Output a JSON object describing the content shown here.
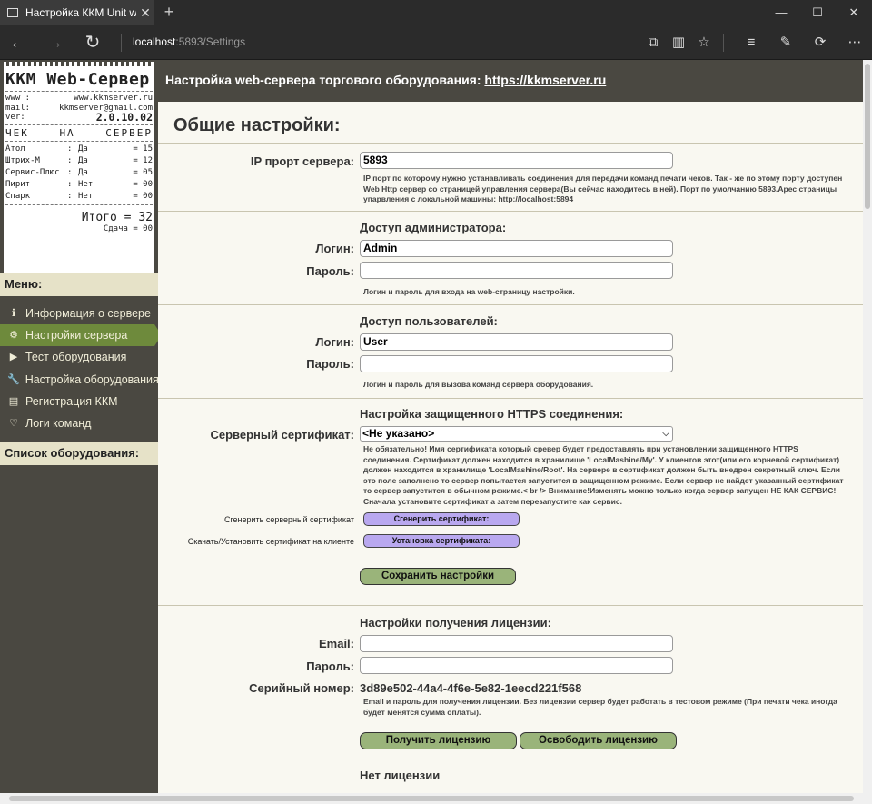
{
  "browser": {
    "tab_title": "Настройка ККМ Unit w",
    "url_host": "localhost",
    "url_path": ":5893/Settings"
  },
  "receipt": {
    "title": "ККМ Web-Сервер",
    "www_label": "www :",
    "www_value": "www.kkmserver.ru",
    "mail_label": "mail:",
    "mail_value": "kkmserver@gmail.com",
    "ver_label": "ver:",
    "ver_value": "2.0.10.02",
    "check_words": [
      "ЧЕК",
      "НА",
      "СЕРВЕР"
    ],
    "rows": [
      {
        "name": "Атол",
        "sep": ":",
        "status": "Да",
        "count": "= 15"
      },
      {
        "name": "Штрих-М",
        "sep": ":",
        "status": "Да",
        "count": "= 12"
      },
      {
        "name": "Сервис-Плюс",
        "sep": ":",
        "status": "Да",
        "count": "= 05"
      },
      {
        "name": "Пирит",
        "sep": ":",
        "status": "Нет",
        "count": "= 00"
      },
      {
        "name": "Спарк",
        "sep": ":",
        "status": "Нет",
        "count": "= 00"
      }
    ],
    "total": "Итого = 32",
    "change": "Сдача = 00"
  },
  "menu": {
    "title": "Меню:",
    "items": [
      {
        "label": "Информация о сервере",
        "icon": "info-icon"
      },
      {
        "label": "Настройки сервера",
        "icon": "gears-icon"
      },
      {
        "label": "Тест оборудования",
        "icon": "play-icon"
      },
      {
        "label": "Настройка оборудования",
        "icon": "wrench-icon"
      },
      {
        "label": "Регистрация ККМ",
        "icon": "register-icon"
      },
      {
        "label": "Логи команд",
        "icon": "heartbeat-icon"
      }
    ],
    "equipment_title": "Список оборудования:"
  },
  "header": {
    "text": "Настройка web-сервера торгового оборудования: ",
    "link": "https://kkmserver.ru"
  },
  "settings": {
    "title": "Общие настройки:",
    "port_label": "IP прорт сервера:",
    "port_value": "5893",
    "port_hint": "IP порт по которому нужно устанавливать соединения для передачи команд печати чеков. Так - же по этому порту доступен Web Http сервер со страницей управления сервера(Вы сейчас находитесь в ней). Порт по умолчанию 5893.Арес страницы упарвления с локальной машины: http://localhost:5894",
    "admin_title": "Доступ администратора:",
    "login_label": "Логин:",
    "password_label": "Пароль:",
    "admin_login": "Admin",
    "admin_hint": "Логин и пароль для входа на web-страницу настройки.",
    "users_title": "Доступ пользователей:",
    "user_login": "User",
    "users_hint": "Логин и пароль для вызова команд сервера оборудования.",
    "https_title": "Настройка защищенного HTTPS соединения:",
    "cert_label": "Серверный сертификат:",
    "cert_value": "<Не указано>",
    "cert_hint": "Не обязательно! Имя сертификата который сревер будет предоставлять при установлении защищенного HTTPS соединения. Сертификат должен находится в хранилище 'LocalMashine/My'. У клиентов этот(или его корневой сертификат) должен находится в хранилище 'LocalMashine/Root'. На сервере в сертификат должен быть внедрен секретный ключ. Если это поле заполнено то сервер попытается запустится в защищенном режиме. Если сервер не найдет указанный сертификат то сервер запустится в обычном режиме.< br /> Внимание!Изменять можно только когда сервер запущен НЕ КАК СЕРВИС!Сначала установите сертификат а затем перезапустите как сервис.",
    "gen_label": "Сгенерить серверный сертификат",
    "gen_button": "Сгенерить сертификат:",
    "install_label": "Скачать/Установить сертификат на клиенте",
    "install_button": "Установка сертификата:",
    "save_button": "Сохранить настройки"
  },
  "license": {
    "title": "Настройки получения лицензии:",
    "email_label": "Email:",
    "password_label": "Пароль:",
    "serial_label": "Серийный номер:",
    "serial_value": "3d89e502-44a4-4f6e-5e82-1eecd221f568",
    "hint": "Email и пароль для получения лицензии. Без лицензии сервер будет работать в тестовом режиме (При печати чека иногда будет менятся сумма оплаты).",
    "get_button": "Получить лицензию",
    "release_button": "Освободить лицензию",
    "status": "Нет лицензии"
  }
}
